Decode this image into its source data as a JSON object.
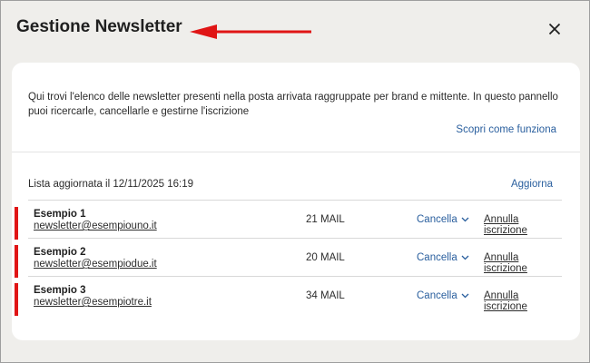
{
  "dialog": {
    "title": "Gestione Newsletter",
    "close_icon": "close-icon",
    "annotation_color": "#e01515"
  },
  "intro": {
    "description": "Qui trovi l'elenco delle newsletter presenti nella posta arrivata raggruppate per brand e mittente. In questo pannello puoi ricercarle, cancellarle e gestirne l'iscrizione",
    "how_link": "Scopri come funziona"
  },
  "list": {
    "updated_text": "Lista aggiornata il 12/11/2025 16:19",
    "refresh_label": "Aggiorna",
    "items": [
      {
        "name": "Esempio 1",
        "email": "newsletter@esempiouno.it",
        "count": "21 MAIL",
        "cancel_label": "Cancella",
        "unsubscribe_label": "Annulla iscrizione"
      },
      {
        "name": "Esempio 2",
        "email": "newsletter@esempiodue.it",
        "count": "20 MAIL",
        "cancel_label": "Cancella",
        "unsubscribe_label": "Annulla iscrizione"
      },
      {
        "name": "Esempio 3",
        "email": "newsletter@esempiotre.it",
        "count": "34 MAIL",
        "cancel_label": "Cancella",
        "unsubscribe_label": "Annulla iscrizione"
      }
    ]
  },
  "colors": {
    "accent_red": "#e01515",
    "link_blue": "#2a5f9e"
  }
}
